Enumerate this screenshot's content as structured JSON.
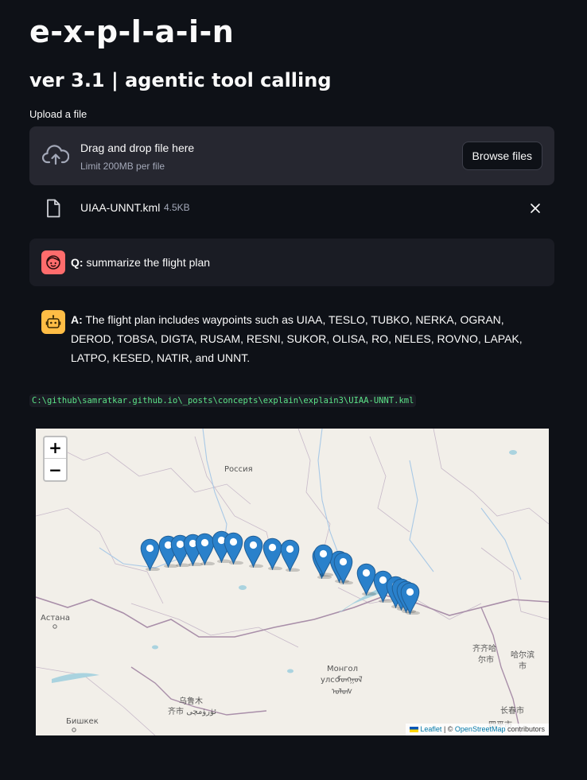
{
  "app": {
    "title": "e-x-p-l-a-i-n",
    "subtitle": "ver 3.1 | agentic tool calling"
  },
  "uploader": {
    "label": "Upload a file",
    "drop_text": "Drag and drop file here",
    "limit_text": "Limit 200MB per file",
    "browse_label": "Browse files",
    "file": {
      "name": "UIAA-UNNT.kml",
      "size": "4.5KB"
    }
  },
  "chat": {
    "question": {
      "prefix": "Q:",
      "text": "summarize the flight plan"
    },
    "answer": {
      "prefix": "A:",
      "text": "The flight plan includes waypoints such as UIAA, TESLO, TUBKO, NERKA, OGRAN, DEROD, TOBSA, DIGTA, RUSAM, RESNI, SUKOR, OLISA, RO, NELES, ROVNO, LAPAK, LATPO, KESED, NATIR, and UNNT."
    }
  },
  "file_path": "C:\\github\\samratkar.github.io\\_posts\\concepts\\explain\\explain3\\UIAA-UNNT.kml",
  "map": {
    "zoom_in": "+",
    "zoom_out": "−",
    "labels": {
      "russia": "Россия",
      "astana": "Астана",
      "mongolia_1": "Монгол",
      "mongolia_2": "улс ᠮᠣᠩᠭᠣᠯ",
      "mongolia_3": "ᠤᠯᠤᠰ",
      "urumqi_1": "乌鲁木",
      "urumqi_2": "齐市 ئۈرۈمچی",
      "bishkek": "Бишкек",
      "qiqihar_1": "齐齐哈",
      "qiqihar_2": "尔市",
      "harbin_1": "哈尔滨",
      "harbin_2": "市",
      "changchun": "长春市",
      "cut_label": "四平市"
    },
    "attribution": {
      "leaflet": "Leaflet",
      "separator": " | © ",
      "osm": "OpenStreetMap",
      "suffix": " contributors"
    },
    "marker_count": 20
  }
}
